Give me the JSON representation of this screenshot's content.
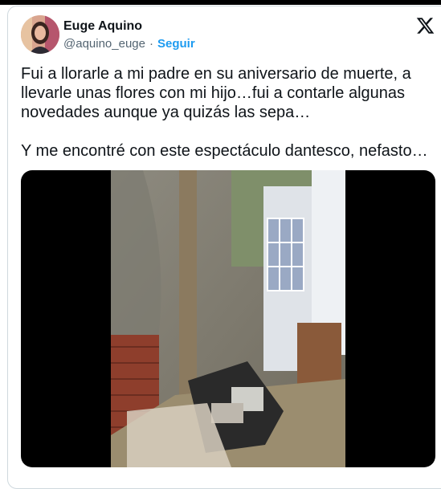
{
  "tweet": {
    "author_name": "Euge Aquino",
    "handle": "@aquino_euge",
    "separator": "·",
    "follow_label": "Seguir",
    "text": "Fui a llorarle a mi padre en su aniversario de muerte, a llevarle unas flores con mi hijo…fui a contarle algunas novedades aunque ya quizás las sepa…\n\nY me encontré con este espectáculo dantesco, nefasto…"
  },
  "icons": {
    "platform": "x-logo-icon",
    "avatar": "profile-photo"
  },
  "colors": {
    "link": "#1d9bf0",
    "secondary_text": "#536471",
    "border": "#cfd9de",
    "media_background": "#000000"
  }
}
